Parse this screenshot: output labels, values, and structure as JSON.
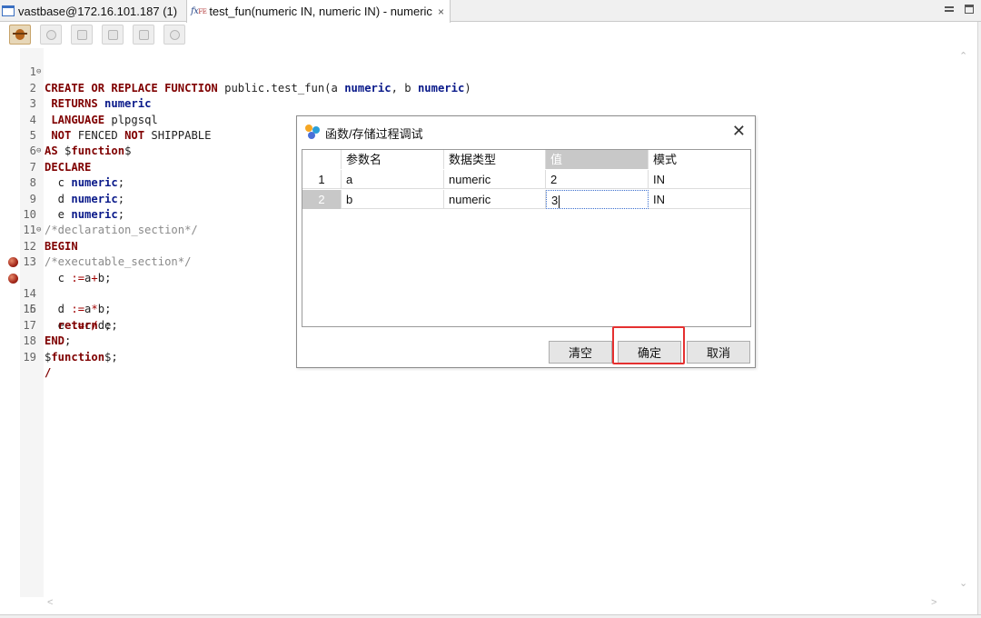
{
  "tabs": [
    {
      "label": "vastbase@172.16.101.187 (1)"
    },
    {
      "icon_text": "fx",
      "icon_sub": "FE",
      "label": "test_fun(numeric IN, numeric IN) - numeric",
      "close": "×"
    }
  ],
  "window_controls": {
    "minimize": "minimize",
    "maximize": "maximize"
  },
  "toolbar": {
    "buttons": [
      "debug",
      "continue",
      "step-into",
      "step-over",
      "step-return",
      "terminate"
    ]
  },
  "editor": {
    "lines": [
      {
        "n": "1",
        "fold": "⊖"
      },
      {
        "n": "2"
      },
      {
        "n": "3"
      },
      {
        "n": "4"
      },
      {
        "n": "5"
      },
      {
        "n": "6",
        "fold": "⊖"
      },
      {
        "n": "7"
      },
      {
        "n": "8"
      },
      {
        "n": "9"
      },
      {
        "n": "10"
      },
      {
        "n": "11",
        "fold": "⊖"
      },
      {
        "n": "12"
      },
      {
        "n": "13"
      },
      {
        "n": "14",
        "breakpoint": true
      },
      {
        "n": "15",
        "breakpoint": true
      },
      {
        "n": "16"
      },
      {
        "n": "17"
      },
      {
        "n": "18"
      },
      {
        "n": "19"
      }
    ],
    "code": {
      "l1": {
        "a": "CREATE OR REPLACE FUNCTION",
        "b": " public.test_fun(a ",
        "c": "numeric",
        "d": ", b ",
        "e": "numeric",
        "f": ")"
      },
      "l2": {
        "a": " RETURNS ",
        "b": "numeric"
      },
      "l3": {
        "a": " LANGUAGE",
        "b": " plpgsql"
      },
      "l4": {
        "a": " NOT",
        "b": " FENCED ",
        "c": "NOT",
        "d": " SHIPPABLE"
      },
      "l5": {
        "a": "AS",
        "b": " $",
        "c": "function",
        "d": "$"
      },
      "l6": {
        "a": "DECLARE"
      },
      "l7": {
        "a": "  c ",
        "b": "numeric",
        "c": ";"
      },
      "l8": {
        "a": "  d ",
        "b": "numeric",
        "c": ";"
      },
      "l9": {
        "a": "  e ",
        "b": "numeric",
        "c": ";"
      },
      "l10": {
        "a": "/*declaration_section*/"
      },
      "l11": {
        "a": "BEGIN"
      },
      "l12": {
        "a": "/*executable_section*/"
      },
      "l13": {
        "a": "  c ",
        "b": ":=",
        "c": "a",
        "d": "+",
        "e": "b;"
      },
      "l14": {
        "a": "  d ",
        "b": ":=",
        "c": "a",
        "d": "*",
        "e": "b;"
      },
      "l15": {
        "a": "  e ",
        "b": ":=",
        "c": "c",
        "d": "/",
        "e": "d;"
      },
      "l16": {
        "a": "  return",
        "b": " e;"
      },
      "l17": {
        "a": "END",
        "b": ";"
      },
      "l18": {
        "a": "$",
        "b": "function",
        "c": "$;"
      },
      "l19": {
        "a": "/"
      }
    }
  },
  "dialog": {
    "title": "函数/存储过程调试",
    "close": "✕",
    "columns": [
      "参数名",
      "数据类型",
      "值",
      "模式"
    ],
    "rows": [
      {
        "num": "1",
        "name": "a",
        "type": "numeric",
        "value": "2",
        "mode": "IN"
      },
      {
        "num": "2",
        "name": "b",
        "type": "numeric",
        "value": "3",
        "mode": "IN"
      }
    ],
    "buttons": {
      "clear": "清空",
      "ok": "确定",
      "cancel": "取消"
    }
  },
  "scroll": {
    "up": "⌃",
    "down": "⌄",
    "left": "<",
    "right": ">"
  },
  "colors": {
    "keyword": "#7f0000",
    "type": "#0a1a8a",
    "comment": "#8a8a8a",
    "highlight": "#e53030",
    "selected_header": "#c8c8c8"
  }
}
